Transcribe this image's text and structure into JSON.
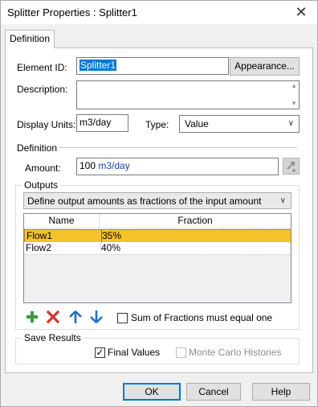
{
  "window": {
    "title": "Splitter Properties : Splitter1",
    "close_icon": "close-icon"
  },
  "tabs": [
    {
      "label": "Definition",
      "selected": true
    }
  ],
  "form": {
    "element_id_label": "Element ID:",
    "element_id_value": "Splitter1",
    "appearance_button": "Appearance...",
    "description_label": "Description:",
    "description_value": "",
    "display_units_label": "Display Units:",
    "display_units_value": "m3/day",
    "type_label": "Type:",
    "type_value": "Value"
  },
  "definition": {
    "section_label": "Definition",
    "amount_label": "Amount:",
    "amount_number": "100",
    "amount_unit": "m3/day",
    "amount_icon": "insert-link-icon"
  },
  "outputs": {
    "group_label": "Outputs",
    "mode_value": "Define output amounts as fractions of the input amount",
    "columns": [
      "Name",
      "Fraction"
    ],
    "rows": [
      {
        "name": "Flow1",
        "fraction": "35%",
        "selected": true
      },
      {
        "name": "Flow2",
        "fraction": "40%",
        "selected": false
      }
    ],
    "toolbar": {
      "add_icon": "plus-icon",
      "add_color": "#3a9a3a",
      "delete_icon": "x-icon",
      "delete_color": "#d9342b",
      "up_icon": "arrow-up-icon",
      "down_icon": "arrow-down-icon",
      "arrow_color": "#1f6fc5"
    },
    "sum_checkbox_label": "Sum of Fractions must equal one",
    "sum_checkbox_checked": false
  },
  "save_results": {
    "group_label": "Save Results",
    "final_values_label": "Final Values",
    "final_values_checked": true,
    "monte_carlo_label": "Monte Carlo Histories",
    "monte_carlo_checked": false,
    "monte_carlo_enabled": false
  },
  "buttons": {
    "ok": "OK",
    "cancel": "Cancel",
    "help": "Help"
  },
  "colors": {
    "selection_highlight": "#f5c22b",
    "accent": "#0078d7",
    "unit_text": "#1f3fa8"
  }
}
